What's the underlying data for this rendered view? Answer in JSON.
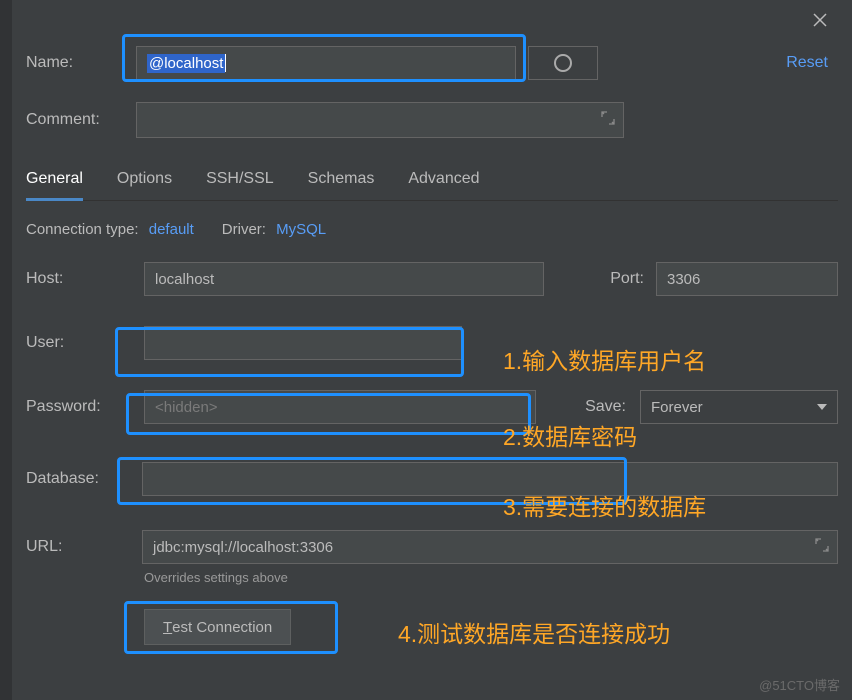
{
  "topbar": {
    "close_icon": "close"
  },
  "header": {
    "name_label": "Name:",
    "name_value": "@localhost",
    "reset": "Reset",
    "comment_label": "Comment:",
    "comment_value": ""
  },
  "tabs": {
    "general": "General",
    "options": "Options",
    "ssh": "SSH/SSL",
    "schemas": "Schemas",
    "advanced": "Advanced",
    "active": "general"
  },
  "subinfo": {
    "conn_type_label": "Connection type:",
    "conn_type_value": "default",
    "driver_label": "Driver:",
    "driver_value": "MySQL"
  },
  "form": {
    "host_label": "Host:",
    "host_value": "localhost",
    "port_label": "Port:",
    "port_value": "3306",
    "user_label": "User:",
    "user_value": "",
    "password_label": "Password:",
    "password_placeholder": "<hidden>",
    "password_value": "",
    "save_label": "Save:",
    "save_value": "Forever",
    "database_label": "Database:",
    "database_value": "",
    "url_label": "URL:",
    "url_value": "jdbc:mysql://localhost:3306",
    "override_note": "Overrides settings above",
    "test_button_prefix": "T",
    "test_button_rest": "est Connection"
  },
  "annotations": {
    "a1": "1.输入数据库用户名",
    "a2": "2.数据库密码",
    "a3": "3.需要连接的数据库",
    "a4": "4.测试数据库是否连接成功"
  },
  "watermark": "@51CTO博客"
}
